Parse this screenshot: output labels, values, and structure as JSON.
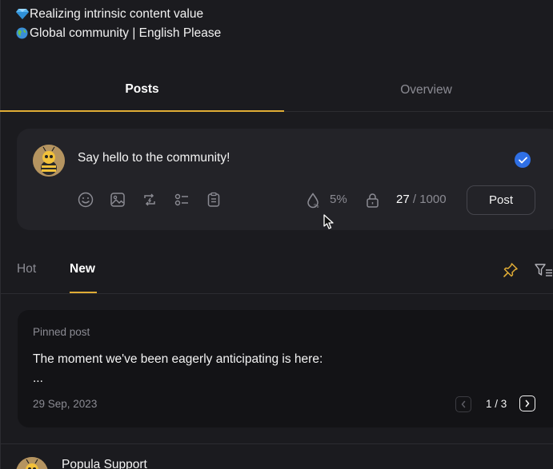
{
  "about": {
    "lines": [
      {
        "icon": "gem-icon",
        "text": "Realizing intrinsic content value"
      },
      {
        "icon": "globe-icon",
        "text": "Global community | English Please"
      }
    ]
  },
  "profile_tabs": [
    {
      "label": "Posts",
      "active": true
    },
    {
      "label": "Overview",
      "active": false
    }
  ],
  "composer": {
    "placeholder": "Say hello to the community!",
    "tools": [
      "emoji-icon",
      "image-icon",
      "repost-icon",
      "poll-icon",
      "clipboard-icon"
    ],
    "percent": "5%",
    "count_current": "27",
    "count_separator": " / ",
    "count_max": "1000",
    "post_label": "Post"
  },
  "feed_tabs": [
    {
      "label": "Hot",
      "active": false
    },
    {
      "label": "New",
      "active": true
    }
  ],
  "pinned": {
    "label": "Pinned post",
    "body_line1": "The moment we've been eagerly anticipating is here:",
    "body_line2": "...",
    "date": "29 Sep, 2023",
    "page": "1 / 3"
  },
  "next_post": {
    "author": "Popula Support"
  },
  "colors": {
    "background": "#1b1b1f",
    "card": "#232328",
    "pinned_card": "#131316",
    "accent_gold": "#e0ac35",
    "check_blue": "#2f6fe4",
    "muted_text": "#8b8b93"
  }
}
